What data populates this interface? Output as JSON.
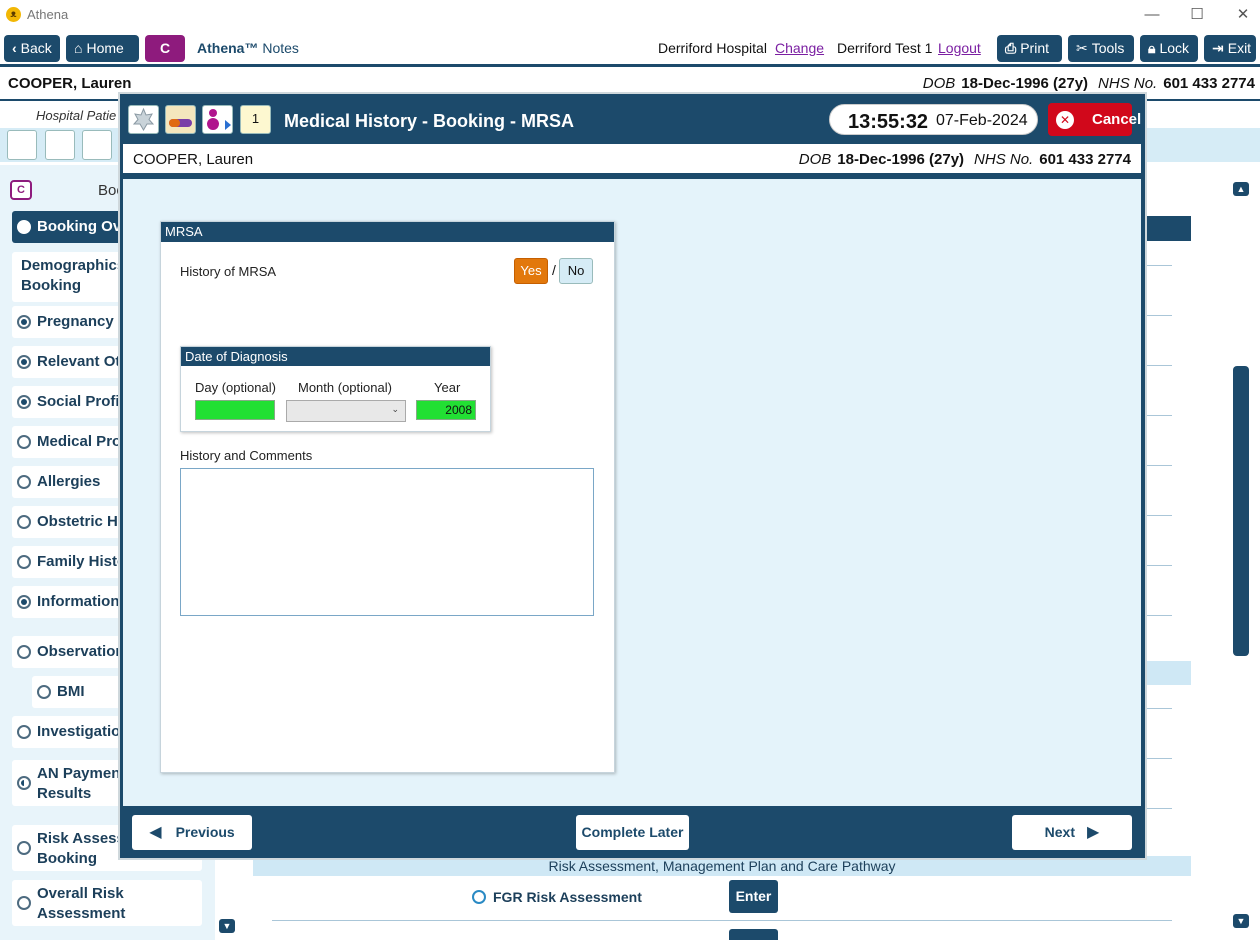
{
  "window": {
    "app_title": "Athena",
    "controls": [
      "—",
      "☐",
      "✕"
    ]
  },
  "toolbar": {
    "back": "Back",
    "home": "Home",
    "c_label": "C",
    "app_name": "Athena™",
    "app_module": "Notes",
    "hospital": "Derriford Hospital",
    "change": "Change",
    "user": "Derriford Test 1",
    "logout": "Logout",
    "print": "Print",
    "tools": "Tools",
    "lock": "Lock",
    "exit": "Exit"
  },
  "patient": {
    "name": "COOPER, Lauren",
    "dob_label": "DOB",
    "dob": "18-Dec-1996 (27y)",
    "nhs_label": "NHS No.",
    "nhs": "601 433 2774"
  },
  "background": {
    "subtitle": "Hospital Patie",
    "section_header_fragment": "Boo",
    "sidebar": [
      {
        "label": "Booking Ove",
        "state": "empty",
        "active": true
      },
      {
        "label": "Demographics",
        "label2": "Booking",
        "state": "none"
      },
      {
        "label": "Pregnancy P",
        "state": "filled"
      },
      {
        "label": "Relevant Oth",
        "state": "filled"
      },
      {
        "label": "Social Profile",
        "state": "filled"
      },
      {
        "label": "Medical Pro",
        "state": "empty"
      },
      {
        "label": "Allergies",
        "state": "empty"
      },
      {
        "label": "Obstetric Hi",
        "state": "empty"
      },
      {
        "label": "Family Histo",
        "state": "empty"
      },
      {
        "label": "Information",
        "state": "filled"
      },
      {
        "label": "Observation",
        "state": "empty"
      },
      {
        "label": "BMI",
        "state": "empty"
      },
      {
        "label": "Investigation",
        "state": "empty"
      },
      {
        "label": "AN Paymen",
        "label2": "Results",
        "state": "half"
      },
      {
        "label": "Risk Assessm",
        "label2": "Booking",
        "state": "empty"
      },
      {
        "label": "Overall Risk",
        "label2": "Assessment",
        "state": "empty"
      }
    ],
    "risk_header": "Risk Assessment, Management Plan and Care Pathway",
    "fgr_label": "FGR Risk Assessment",
    "enter": "Enter"
  },
  "modal": {
    "title": "Medical History - Booking - MRSA",
    "calendar_day": "1",
    "time": "13:55:32",
    "date": "07-Feb-2024",
    "cancel": "Cancel",
    "panel_title": "MRSA",
    "history_question": "History of MRSA",
    "yes": "Yes",
    "slash": "/",
    "no": "No",
    "selected_answer": "Yes",
    "diagnosis": {
      "title": "Date of Diagnosis",
      "day_label": "Day (optional)",
      "day_value": "",
      "month_label": "Month (optional)",
      "month_value": "",
      "year_label": "Year",
      "year_value": "2008"
    },
    "comments_label": "History and Comments",
    "comments_value": "",
    "previous": "Previous",
    "complete_later": "Complete Later",
    "next": "Next"
  },
  "colors": {
    "navy": "#1c4a6b",
    "yes_selected": "#e2780c",
    "cancel_red": "#d1081b",
    "field_green": "#22e033",
    "module_purple": "#8e1b7d"
  }
}
